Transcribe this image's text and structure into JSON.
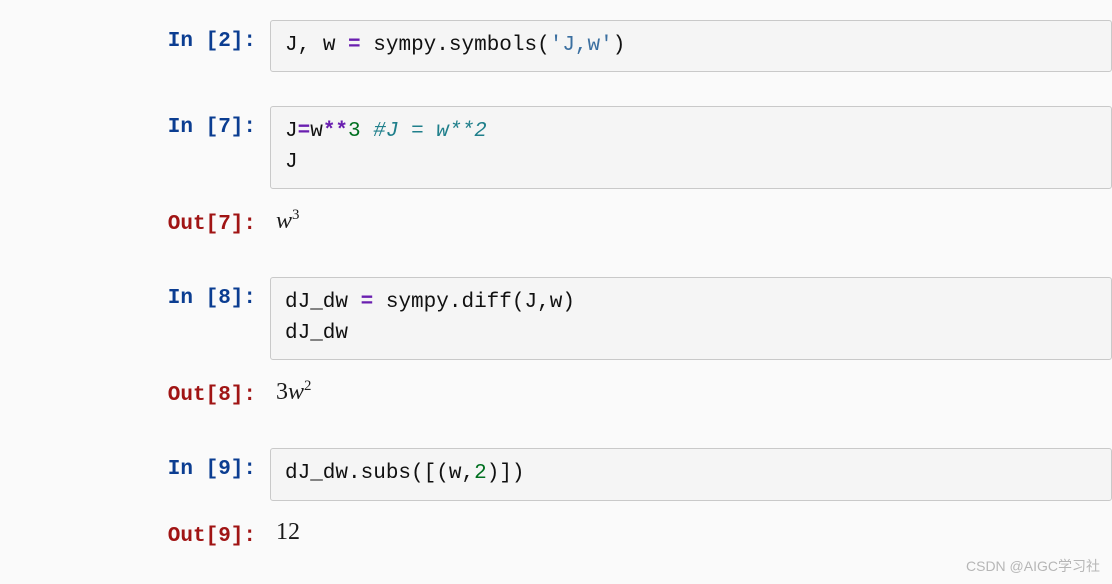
{
  "cells": [
    {
      "in_n": "2",
      "code": "J, w = sympy.symbols('J,w')",
      "tokens": [
        {
          "t": "J",
          "c": "code-name"
        },
        {
          "t": ", ",
          "c": "code-punct"
        },
        {
          "t": "w",
          "c": "code-name"
        },
        {
          "t": " ",
          "c": "code-punct"
        },
        {
          "t": "=",
          "c": "code-op"
        },
        {
          "t": " ",
          "c": "code-punct"
        },
        {
          "t": "sympy",
          "c": "code-name"
        },
        {
          "t": ".",
          "c": "code-punct"
        },
        {
          "t": "symbols",
          "c": "code-func"
        },
        {
          "t": "(",
          "c": "code-punct"
        },
        {
          "t": "'J,w'",
          "c": "code-str"
        },
        {
          "t": ")",
          "c": "code-punct"
        }
      ],
      "output_type": "none"
    },
    {
      "in_n": "7",
      "code": "J=w**3 #J = w**2\nJ",
      "tokens": [
        {
          "t": "J",
          "c": "code-name"
        },
        {
          "t": "=",
          "c": "code-op"
        },
        {
          "t": "w",
          "c": "code-name"
        },
        {
          "t": "**",
          "c": "code-op"
        },
        {
          "t": "3",
          "c": "code-num"
        },
        {
          "t": " ",
          "c": "code-punct"
        },
        {
          "t": "#J = w**2",
          "c": "code-comment"
        },
        {
          "t": "\n",
          "c": "code-punct"
        },
        {
          "t": "J",
          "c": "code-name"
        }
      ],
      "output_type": "math",
      "output_math": {
        "pre": "",
        "base": "w",
        "sup": "3"
      }
    },
    {
      "in_n": "8",
      "code": "dJ_dw = sympy.diff(J,w)\ndJ_dw",
      "tokens": [
        {
          "t": "dJ_dw",
          "c": "code-name"
        },
        {
          "t": " ",
          "c": "code-punct"
        },
        {
          "t": "=",
          "c": "code-op"
        },
        {
          "t": " ",
          "c": "code-punct"
        },
        {
          "t": "sympy",
          "c": "code-name"
        },
        {
          "t": ".",
          "c": "code-punct"
        },
        {
          "t": "diff",
          "c": "code-func"
        },
        {
          "t": "(",
          "c": "code-punct"
        },
        {
          "t": "J",
          "c": "code-name"
        },
        {
          "t": ",",
          "c": "code-punct"
        },
        {
          "t": "w",
          "c": "code-name"
        },
        {
          "t": ")",
          "c": "code-punct"
        },
        {
          "t": "\n",
          "c": "code-punct"
        },
        {
          "t": "dJ_dw",
          "c": "code-name"
        }
      ],
      "output_type": "math",
      "output_math": {
        "pre": "3",
        "base": "w",
        "sup": "2"
      }
    },
    {
      "in_n": "9",
      "code": "dJ_dw.subs([(w,2)])",
      "tokens": [
        {
          "t": "dJ_dw",
          "c": "code-name"
        },
        {
          "t": ".",
          "c": "code-punct"
        },
        {
          "t": "subs",
          "c": "code-func"
        },
        {
          "t": "(",
          "c": "code-punct"
        },
        {
          "t": "[",
          "c": "code-punct"
        },
        {
          "t": "(",
          "c": "code-punct"
        },
        {
          "t": "w",
          "c": "code-name"
        },
        {
          "t": ",",
          "c": "code-punct"
        },
        {
          "t": "2",
          "c": "code-num"
        },
        {
          "t": ")",
          "c": "code-punct"
        },
        {
          "t": "]",
          "c": "code-punct"
        },
        {
          "t": ")",
          "c": "code-punct"
        }
      ],
      "output_type": "text",
      "output_text": "12"
    }
  ],
  "prompt_in_prefix": "In [",
  "prompt_out_prefix": "Out[",
  "prompt_suffix": "]:",
  "watermark": "CSDN @AIGC学习社"
}
